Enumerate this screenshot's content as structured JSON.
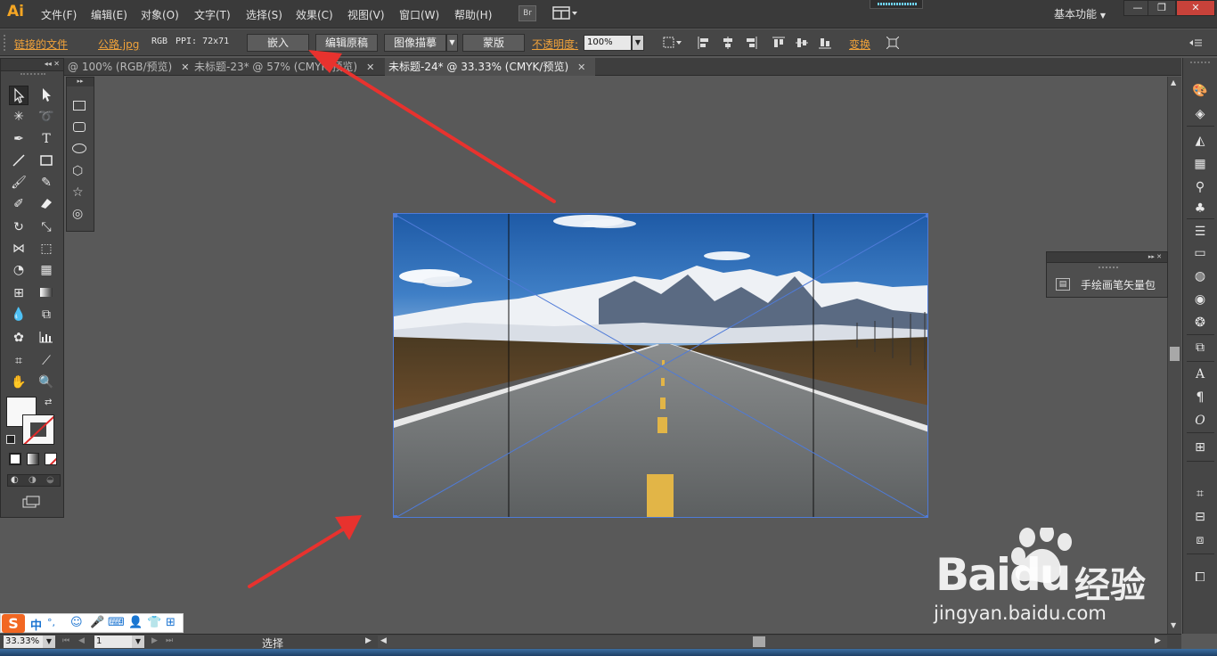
{
  "app": {
    "logo": "Ai"
  },
  "menu": {
    "items": [
      "文件(F)",
      "编辑(E)",
      "对象(O)",
      "文字(T)",
      "选择(S)",
      "效果(C)",
      "视图(V)",
      "窗口(W)",
      "帮助(H)"
    ],
    "bridge_label": "Br",
    "workspace": "基本功能",
    "workspace_arrow": "▼"
  },
  "window_controls": {
    "minimize": "—",
    "restore": "❐",
    "close": "✕"
  },
  "control_bar": {
    "linked_file_label": "链接的文件",
    "file_name": "公路.jpg",
    "color_mode": "RGB",
    "ppi": "PPI: 72x71",
    "embed_button": "嵌入",
    "edit_original_button": "编辑原稿",
    "image_trace_button": "图像描摹",
    "mask_button": "蒙版",
    "opacity_label": "不透明度:",
    "opacity_value": "100%",
    "transform_label": "变换"
  },
  "tabs": [
    {
      "label": "@ 100% (RGB/预览)",
      "active": false,
      "close": "✕"
    },
    {
      "label": "未标题-23* @ 57% (CMYK/预览)",
      "active": false,
      "close": "✕"
    },
    {
      "label": "未标题-24* @ 33.33% (CMYK/预览)",
      "active": true,
      "close": "✕"
    }
  ],
  "tools": {
    "panel_arrows": "◂◂ ✕",
    "flyout_arrows": "▸▸"
  },
  "brush_panel": {
    "arrows": "▸▸ ✕",
    "item_label": "手绘画笔矢量包"
  },
  "status_bar": {
    "zoom": "33.33%",
    "page": "1",
    "current_tool": "选择",
    "play_arrow": "▶",
    "left_arrow": "◀",
    "right_arrow": "▶"
  },
  "ime": {
    "logo": "S",
    "mode": "中"
  },
  "watermark": {
    "brand": "Baidu",
    "brand_cn": "经验",
    "url": "jingyan.baidu.com"
  },
  "colors": {
    "accent_link": "#f0a23a",
    "selection_blue": "#4f7bd8",
    "annotation_red": "#e8322e"
  }
}
